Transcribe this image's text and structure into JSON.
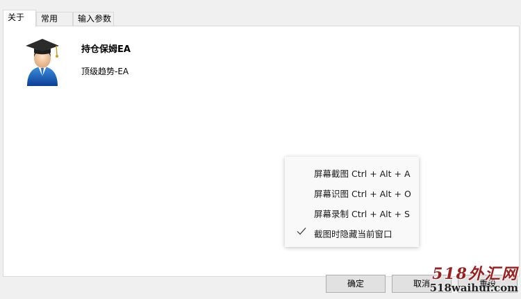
{
  "tabs": [
    {
      "label": "关于",
      "active": true
    },
    {
      "label": "常用",
      "active": false
    },
    {
      "label": "输入参数",
      "active": false
    }
  ],
  "about": {
    "title": "持仓保姆EA",
    "subtitle": "顶级趋势-EA",
    "avatar_icon": "graduate-user-icon"
  },
  "context_menu": {
    "items": [
      {
        "label": "屏幕截图 Ctrl + Alt + A",
        "checked": false
      },
      {
        "label": "屏幕识图 Ctrl + Alt + O",
        "checked": false
      },
      {
        "label": "屏幕录制 Ctrl + Alt + S",
        "checked": false
      },
      {
        "label": "截图时隐藏当前窗口",
        "checked": true
      }
    ]
  },
  "buttons": {
    "ok": "确定",
    "cancel": "取消",
    "reset": "重设"
  },
  "watermark": {
    "logo_text": "518外汇网",
    "url": "518waihui.com"
  },
  "colors": {
    "panel_bg": "#ffffff",
    "window_bg": "#f0f0f0",
    "watermark_red": "#9a2020"
  }
}
